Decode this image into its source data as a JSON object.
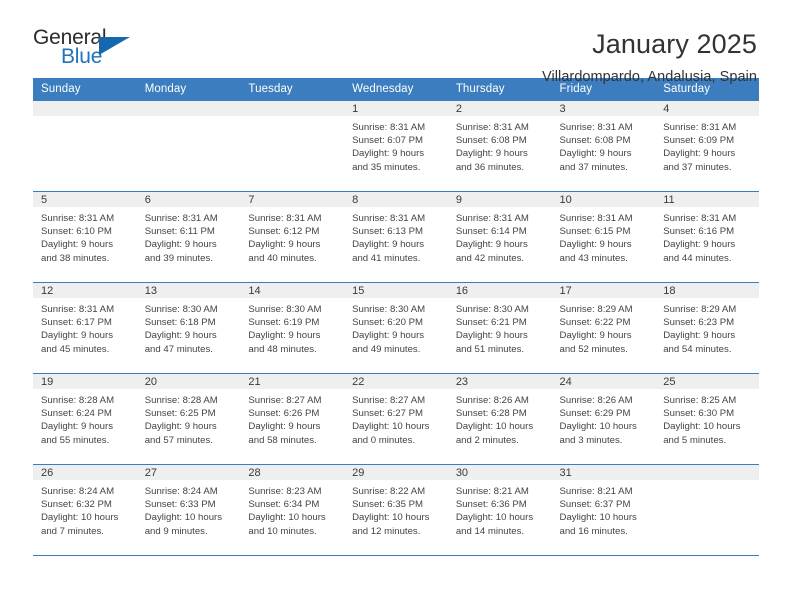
{
  "brand": {
    "name_part1": "General",
    "name_part2": "Blue",
    "triangle_color": "#1668ae",
    "blue_color": "#1f72bd"
  },
  "header": {
    "title": "January 2025",
    "subtitle": "Villardompardo, Andalusia, Spain",
    "header_bg": "#3b7dbf",
    "daynum_bg": "#efefef"
  },
  "weekdays": [
    "Sunday",
    "Monday",
    "Tuesday",
    "Wednesday",
    "Thursday",
    "Friday",
    "Saturday"
  ],
  "weeks": [
    [
      {
        "day": "",
        "sunrise": "",
        "sunset": "",
        "daylight1": "",
        "daylight2": ""
      },
      {
        "day": "",
        "sunrise": "",
        "sunset": "",
        "daylight1": "",
        "daylight2": ""
      },
      {
        "day": "",
        "sunrise": "",
        "sunset": "",
        "daylight1": "",
        "daylight2": ""
      },
      {
        "day": "1",
        "sunrise": "Sunrise: 8:31 AM",
        "sunset": "Sunset: 6:07 PM",
        "daylight1": "Daylight: 9 hours",
        "daylight2": "and 35 minutes."
      },
      {
        "day": "2",
        "sunrise": "Sunrise: 8:31 AM",
        "sunset": "Sunset: 6:08 PM",
        "daylight1": "Daylight: 9 hours",
        "daylight2": "and 36 minutes."
      },
      {
        "day": "3",
        "sunrise": "Sunrise: 8:31 AM",
        "sunset": "Sunset: 6:08 PM",
        "daylight1": "Daylight: 9 hours",
        "daylight2": "and 37 minutes."
      },
      {
        "day": "4",
        "sunrise": "Sunrise: 8:31 AM",
        "sunset": "Sunset: 6:09 PM",
        "daylight1": "Daylight: 9 hours",
        "daylight2": "and 37 minutes."
      }
    ],
    [
      {
        "day": "5",
        "sunrise": "Sunrise: 8:31 AM",
        "sunset": "Sunset: 6:10 PM",
        "daylight1": "Daylight: 9 hours",
        "daylight2": "and 38 minutes."
      },
      {
        "day": "6",
        "sunrise": "Sunrise: 8:31 AM",
        "sunset": "Sunset: 6:11 PM",
        "daylight1": "Daylight: 9 hours",
        "daylight2": "and 39 minutes."
      },
      {
        "day": "7",
        "sunrise": "Sunrise: 8:31 AM",
        "sunset": "Sunset: 6:12 PM",
        "daylight1": "Daylight: 9 hours",
        "daylight2": "and 40 minutes."
      },
      {
        "day": "8",
        "sunrise": "Sunrise: 8:31 AM",
        "sunset": "Sunset: 6:13 PM",
        "daylight1": "Daylight: 9 hours",
        "daylight2": "and 41 minutes."
      },
      {
        "day": "9",
        "sunrise": "Sunrise: 8:31 AM",
        "sunset": "Sunset: 6:14 PM",
        "daylight1": "Daylight: 9 hours",
        "daylight2": "and 42 minutes."
      },
      {
        "day": "10",
        "sunrise": "Sunrise: 8:31 AM",
        "sunset": "Sunset: 6:15 PM",
        "daylight1": "Daylight: 9 hours",
        "daylight2": "and 43 minutes."
      },
      {
        "day": "11",
        "sunrise": "Sunrise: 8:31 AM",
        "sunset": "Sunset: 6:16 PM",
        "daylight1": "Daylight: 9 hours",
        "daylight2": "and 44 minutes."
      }
    ],
    [
      {
        "day": "12",
        "sunrise": "Sunrise: 8:31 AM",
        "sunset": "Sunset: 6:17 PM",
        "daylight1": "Daylight: 9 hours",
        "daylight2": "and 45 minutes."
      },
      {
        "day": "13",
        "sunrise": "Sunrise: 8:30 AM",
        "sunset": "Sunset: 6:18 PM",
        "daylight1": "Daylight: 9 hours",
        "daylight2": "and 47 minutes."
      },
      {
        "day": "14",
        "sunrise": "Sunrise: 8:30 AM",
        "sunset": "Sunset: 6:19 PM",
        "daylight1": "Daylight: 9 hours",
        "daylight2": "and 48 minutes."
      },
      {
        "day": "15",
        "sunrise": "Sunrise: 8:30 AM",
        "sunset": "Sunset: 6:20 PM",
        "daylight1": "Daylight: 9 hours",
        "daylight2": "and 49 minutes."
      },
      {
        "day": "16",
        "sunrise": "Sunrise: 8:30 AM",
        "sunset": "Sunset: 6:21 PM",
        "daylight1": "Daylight: 9 hours",
        "daylight2": "and 51 minutes."
      },
      {
        "day": "17",
        "sunrise": "Sunrise: 8:29 AM",
        "sunset": "Sunset: 6:22 PM",
        "daylight1": "Daylight: 9 hours",
        "daylight2": "and 52 minutes."
      },
      {
        "day": "18",
        "sunrise": "Sunrise: 8:29 AM",
        "sunset": "Sunset: 6:23 PM",
        "daylight1": "Daylight: 9 hours",
        "daylight2": "and 54 minutes."
      }
    ],
    [
      {
        "day": "19",
        "sunrise": "Sunrise: 8:28 AM",
        "sunset": "Sunset: 6:24 PM",
        "daylight1": "Daylight: 9 hours",
        "daylight2": "and 55 minutes."
      },
      {
        "day": "20",
        "sunrise": "Sunrise: 8:28 AM",
        "sunset": "Sunset: 6:25 PM",
        "daylight1": "Daylight: 9 hours",
        "daylight2": "and 57 minutes."
      },
      {
        "day": "21",
        "sunrise": "Sunrise: 8:27 AM",
        "sunset": "Sunset: 6:26 PM",
        "daylight1": "Daylight: 9 hours",
        "daylight2": "and 58 minutes."
      },
      {
        "day": "22",
        "sunrise": "Sunrise: 8:27 AM",
        "sunset": "Sunset: 6:27 PM",
        "daylight1": "Daylight: 10 hours",
        "daylight2": "and 0 minutes."
      },
      {
        "day": "23",
        "sunrise": "Sunrise: 8:26 AM",
        "sunset": "Sunset: 6:28 PM",
        "daylight1": "Daylight: 10 hours",
        "daylight2": "and 2 minutes."
      },
      {
        "day": "24",
        "sunrise": "Sunrise: 8:26 AM",
        "sunset": "Sunset: 6:29 PM",
        "daylight1": "Daylight: 10 hours",
        "daylight2": "and 3 minutes."
      },
      {
        "day": "25",
        "sunrise": "Sunrise: 8:25 AM",
        "sunset": "Sunset: 6:30 PM",
        "daylight1": "Daylight: 10 hours",
        "daylight2": "and 5 minutes."
      }
    ],
    [
      {
        "day": "26",
        "sunrise": "Sunrise: 8:24 AM",
        "sunset": "Sunset: 6:32 PM",
        "daylight1": "Daylight: 10 hours",
        "daylight2": "and 7 minutes."
      },
      {
        "day": "27",
        "sunrise": "Sunrise: 8:24 AM",
        "sunset": "Sunset: 6:33 PM",
        "daylight1": "Daylight: 10 hours",
        "daylight2": "and 9 minutes."
      },
      {
        "day": "28",
        "sunrise": "Sunrise: 8:23 AM",
        "sunset": "Sunset: 6:34 PM",
        "daylight1": "Daylight: 10 hours",
        "daylight2": "and 10 minutes."
      },
      {
        "day": "29",
        "sunrise": "Sunrise: 8:22 AM",
        "sunset": "Sunset: 6:35 PM",
        "daylight1": "Daylight: 10 hours",
        "daylight2": "and 12 minutes."
      },
      {
        "day": "30",
        "sunrise": "Sunrise: 8:21 AM",
        "sunset": "Sunset: 6:36 PM",
        "daylight1": "Daylight: 10 hours",
        "daylight2": "and 14 minutes."
      },
      {
        "day": "31",
        "sunrise": "Sunrise: 8:21 AM",
        "sunset": "Sunset: 6:37 PM",
        "daylight1": "Daylight: 10 hours",
        "daylight2": "and 16 minutes."
      },
      {
        "day": "",
        "sunrise": "",
        "sunset": "",
        "daylight1": "",
        "daylight2": ""
      }
    ]
  ]
}
